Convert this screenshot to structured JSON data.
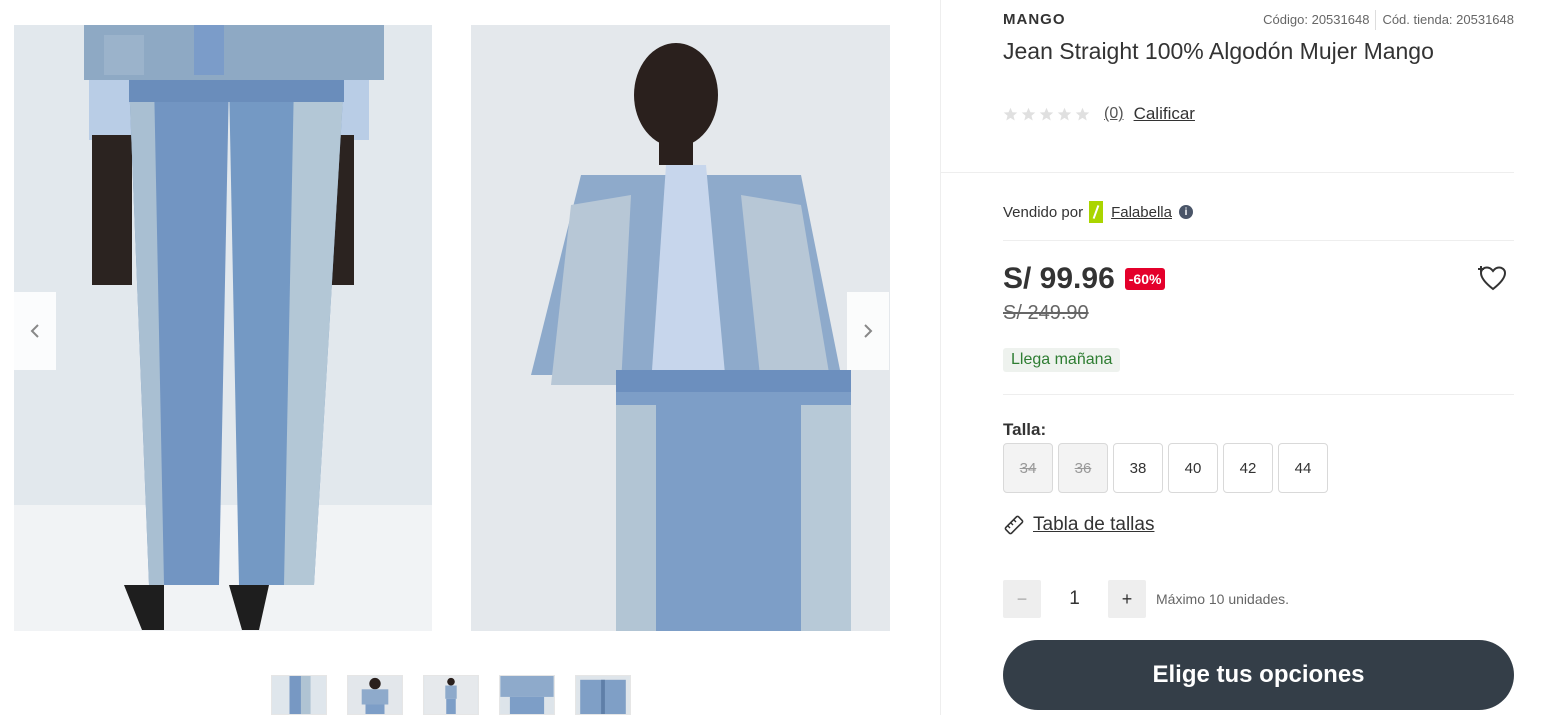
{
  "product": {
    "brand": "MANGO",
    "code": "Código: 20531648",
    "store_code": "Cód. tienda: 20531648",
    "title": "Jean Straight 100% Algodón Mujer Mango"
  },
  "rating": {
    "stars": 0,
    "count": "(0)",
    "rate_link": "Calificar"
  },
  "seller": {
    "label": "Vendido por",
    "name": "Falabella",
    "info_icon": "info-icon"
  },
  "pricing": {
    "price": "S/ 99.96",
    "discount": "-60%",
    "old_price": "S/ 249.90",
    "wishlist_icon": "heart-plus-icon"
  },
  "delivery": {
    "label": "Llega mañana"
  },
  "sizes": {
    "label": "Talla:",
    "options": [
      {
        "value": "34",
        "available": false
      },
      {
        "value": "36",
        "available": false
      },
      {
        "value": "38",
        "available": true
      },
      {
        "value": "40",
        "available": true
      },
      {
        "value": "42",
        "available": true
      },
      {
        "value": "44",
        "available": true
      }
    ],
    "guide_label": "Tabla de tallas",
    "guide_icon": "ruler-icon"
  },
  "quantity": {
    "minus": "−",
    "value": "1",
    "plus": "+",
    "max_label": "Máximo 10 unidades."
  },
  "cta": {
    "label": "Elige tus opciones"
  },
  "gallery": {
    "prev_icon": "chevron-left-icon",
    "next_icon": "chevron-right-icon",
    "thumbnail_count": 5
  },
  "colors": {
    "cta_bg": "#343e48",
    "discount_bg": "#e4002b",
    "delivery_text": "#2e7d32",
    "seller_brand": "#aad500",
    "denim_dark": "#6f93bd",
    "denim_light": "#a9c0d3"
  }
}
